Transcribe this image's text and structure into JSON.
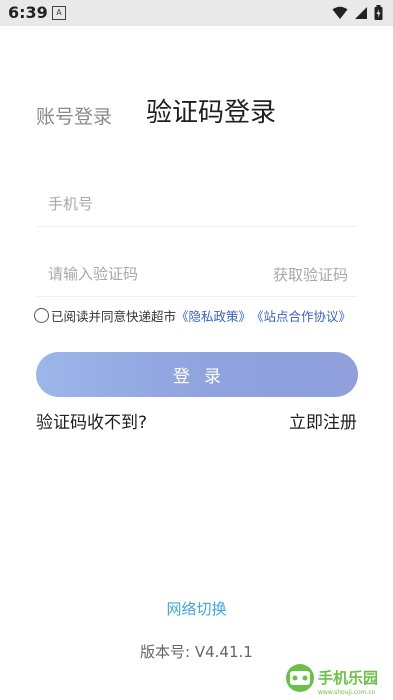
{
  "status_bar": {
    "time": "6:39",
    "notification_letter": "A"
  },
  "tabs": {
    "account_login": "账号登录",
    "code_login": "验证码登录"
  },
  "phone": {
    "placeholder": "手机号",
    "value": ""
  },
  "code": {
    "placeholder": "请输入验证码",
    "value": "",
    "get_code": "获取验证码"
  },
  "agreement": {
    "checked": false,
    "text": "已阅读并同意快递超市",
    "privacy_link": "《隐私政策》",
    "cooperation_link": "《站点合作协议》"
  },
  "login_button": "登录",
  "no_code_link": "验证码收不到?",
  "register_link": "立即注册",
  "network_switch": "网络切换",
  "version": {
    "label": "版本号:",
    "value": "V4.41.1"
  },
  "watermark": {
    "text": "手机乐园",
    "subtext": "www.shouji.com.cn"
  },
  "colors": {
    "button_start": "#9cb6ea",
    "button_end": "#8fa0dc",
    "link": "#3b5fc0",
    "network": "#45a4de"
  }
}
